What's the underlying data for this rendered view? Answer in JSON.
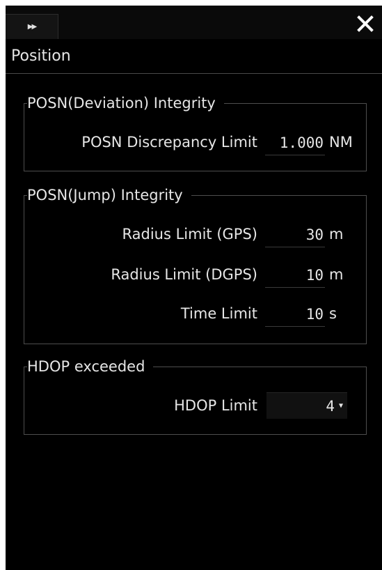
{
  "titlebar": {
    "expand_icon": "double-chevron-right-icon",
    "close_icon": "close-icon"
  },
  "panel": {
    "title": "Position"
  },
  "deviation_group": {
    "legend": "POSN(Deviation) Integrity",
    "discrepancy": {
      "label": "POSN Discrepancy Limit",
      "value": "1.000",
      "unit": "NM"
    }
  },
  "jump_group": {
    "legend": "POSN(Jump) Integrity",
    "rows": [
      {
        "label": "Radius Limit (GPS)",
        "value": "30",
        "unit": "m"
      },
      {
        "label": "Radius Limit (DGPS)",
        "value": "10",
        "unit": "m"
      },
      {
        "label": "Time Limit",
        "value": "10",
        "unit": "s"
      }
    ]
  },
  "hdop_group": {
    "legend": "HDOP exceeded",
    "limit": {
      "label": "HDOP Limit",
      "value": "4"
    }
  }
}
